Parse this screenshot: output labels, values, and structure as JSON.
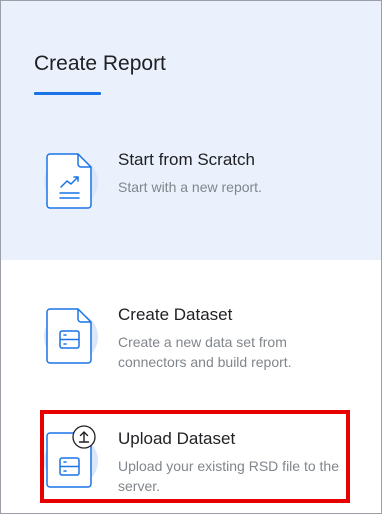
{
  "header": {
    "title": "Create Report"
  },
  "options": [
    {
      "title": "Start from Scratch",
      "description": "Start with a new report.",
      "icon": "report-chart-icon"
    },
    {
      "title": "Create Dataset",
      "description": "Create a new data set from connectors and build report.",
      "icon": "dataset-icon"
    },
    {
      "title": "Upload Dataset",
      "description": "Upload your existing RSD file to the server.",
      "icon": "upload-dataset-icon"
    }
  ],
  "colors": {
    "accent": "#1a73e8",
    "header_bg": "#eaf1fc",
    "highlight": "#e60000"
  }
}
